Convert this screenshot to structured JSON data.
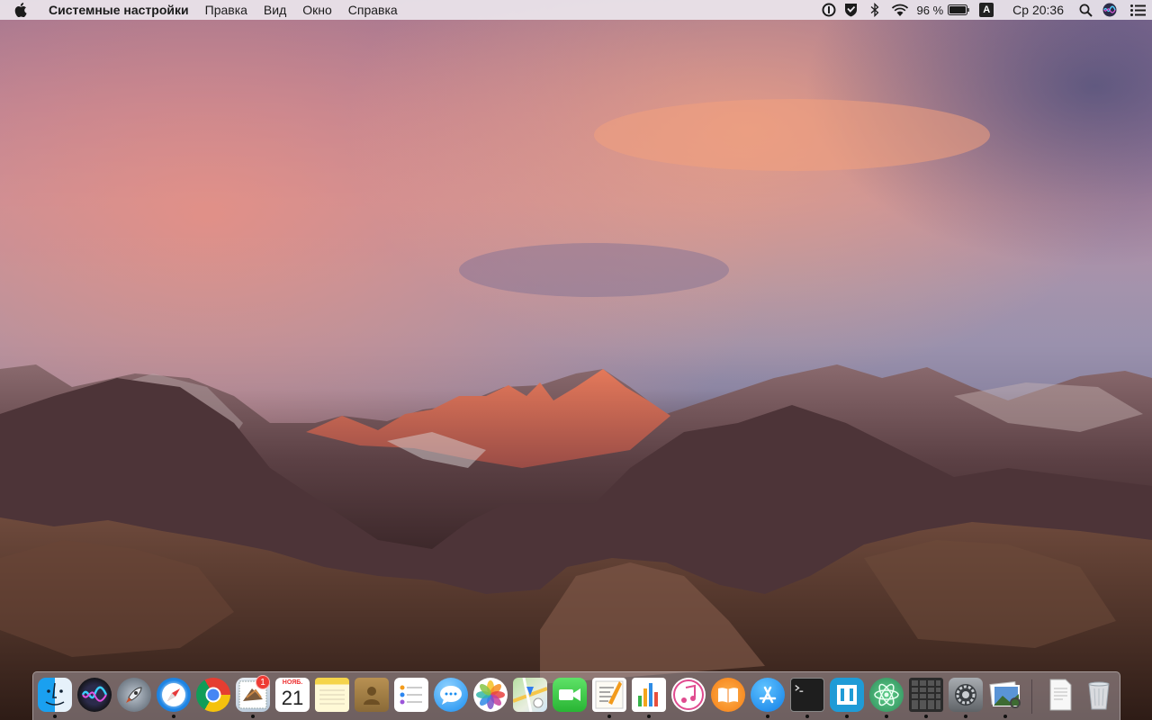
{
  "menubar": {
    "apple_icon": "apple-logo-icon",
    "app_name": "Системные настройки",
    "menus": [
      "Правка",
      "Вид",
      "Окно",
      "Справка"
    ],
    "status": {
      "battery_percent": "96 %",
      "input_source": "A",
      "clock": "Ср 20:36"
    }
  },
  "dock": {
    "calendar": {
      "month": "НОЯБ.",
      "day": "21"
    },
    "mail_badge": "1",
    "apps": [
      "Finder",
      "Siri",
      "Launchpad",
      "Safari",
      "Google Chrome",
      "Mail",
      "Calendar",
      "Notes",
      "Contacts",
      "Reminders",
      "Messages",
      "Photos",
      "Maps",
      "FaceTime",
      "Pages",
      "Numbers",
      "iTunes",
      "iBooks",
      "App Store",
      "Terminal",
      "Tower",
      "Atom",
      "Activity Monitor",
      "System Preferences",
      "Preview"
    ]
  },
  "colors": {
    "menubar_bg": "#ece8ee",
    "badge_red": "#ee3b34",
    "sky_pink": "#e98a7a",
    "sky_violet": "#8f86a6"
  }
}
